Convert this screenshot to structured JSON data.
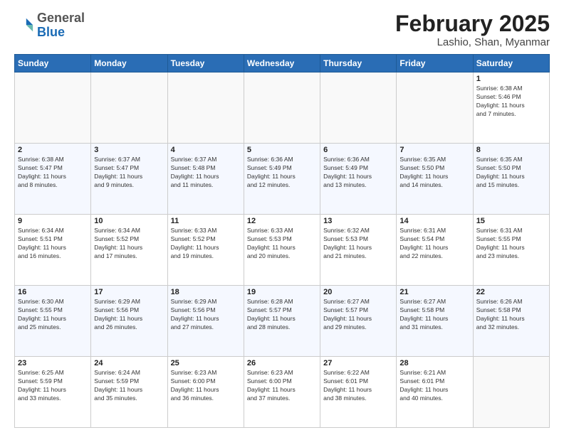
{
  "logo": {
    "general": "General",
    "blue": "Blue"
  },
  "header": {
    "title": "February 2025",
    "subtitle": "Lashio, Shan, Myanmar"
  },
  "weekdays": [
    "Sunday",
    "Monday",
    "Tuesday",
    "Wednesday",
    "Thursday",
    "Friday",
    "Saturday"
  ],
  "weeks": [
    [
      {
        "day": "",
        "info": ""
      },
      {
        "day": "",
        "info": ""
      },
      {
        "day": "",
        "info": ""
      },
      {
        "day": "",
        "info": ""
      },
      {
        "day": "",
        "info": ""
      },
      {
        "day": "",
        "info": ""
      },
      {
        "day": "1",
        "info": "Sunrise: 6:38 AM\nSunset: 5:46 PM\nDaylight: 11 hours\nand 7 minutes."
      }
    ],
    [
      {
        "day": "2",
        "info": "Sunrise: 6:38 AM\nSunset: 5:47 PM\nDaylight: 11 hours\nand 8 minutes."
      },
      {
        "day": "3",
        "info": "Sunrise: 6:37 AM\nSunset: 5:47 PM\nDaylight: 11 hours\nand 9 minutes."
      },
      {
        "day": "4",
        "info": "Sunrise: 6:37 AM\nSunset: 5:48 PM\nDaylight: 11 hours\nand 11 minutes."
      },
      {
        "day": "5",
        "info": "Sunrise: 6:36 AM\nSunset: 5:49 PM\nDaylight: 11 hours\nand 12 minutes."
      },
      {
        "day": "6",
        "info": "Sunrise: 6:36 AM\nSunset: 5:49 PM\nDaylight: 11 hours\nand 13 minutes."
      },
      {
        "day": "7",
        "info": "Sunrise: 6:35 AM\nSunset: 5:50 PM\nDaylight: 11 hours\nand 14 minutes."
      },
      {
        "day": "8",
        "info": "Sunrise: 6:35 AM\nSunset: 5:50 PM\nDaylight: 11 hours\nand 15 minutes."
      }
    ],
    [
      {
        "day": "9",
        "info": "Sunrise: 6:34 AM\nSunset: 5:51 PM\nDaylight: 11 hours\nand 16 minutes."
      },
      {
        "day": "10",
        "info": "Sunrise: 6:34 AM\nSunset: 5:52 PM\nDaylight: 11 hours\nand 17 minutes."
      },
      {
        "day": "11",
        "info": "Sunrise: 6:33 AM\nSunset: 5:52 PM\nDaylight: 11 hours\nand 19 minutes."
      },
      {
        "day": "12",
        "info": "Sunrise: 6:33 AM\nSunset: 5:53 PM\nDaylight: 11 hours\nand 20 minutes."
      },
      {
        "day": "13",
        "info": "Sunrise: 6:32 AM\nSunset: 5:53 PM\nDaylight: 11 hours\nand 21 minutes."
      },
      {
        "day": "14",
        "info": "Sunrise: 6:31 AM\nSunset: 5:54 PM\nDaylight: 11 hours\nand 22 minutes."
      },
      {
        "day": "15",
        "info": "Sunrise: 6:31 AM\nSunset: 5:55 PM\nDaylight: 11 hours\nand 23 minutes."
      }
    ],
    [
      {
        "day": "16",
        "info": "Sunrise: 6:30 AM\nSunset: 5:55 PM\nDaylight: 11 hours\nand 25 minutes."
      },
      {
        "day": "17",
        "info": "Sunrise: 6:29 AM\nSunset: 5:56 PM\nDaylight: 11 hours\nand 26 minutes."
      },
      {
        "day": "18",
        "info": "Sunrise: 6:29 AM\nSunset: 5:56 PM\nDaylight: 11 hours\nand 27 minutes."
      },
      {
        "day": "19",
        "info": "Sunrise: 6:28 AM\nSunset: 5:57 PM\nDaylight: 11 hours\nand 28 minutes."
      },
      {
        "day": "20",
        "info": "Sunrise: 6:27 AM\nSunset: 5:57 PM\nDaylight: 11 hours\nand 29 minutes."
      },
      {
        "day": "21",
        "info": "Sunrise: 6:27 AM\nSunset: 5:58 PM\nDaylight: 11 hours\nand 31 minutes."
      },
      {
        "day": "22",
        "info": "Sunrise: 6:26 AM\nSunset: 5:58 PM\nDaylight: 11 hours\nand 32 minutes."
      }
    ],
    [
      {
        "day": "23",
        "info": "Sunrise: 6:25 AM\nSunset: 5:59 PM\nDaylight: 11 hours\nand 33 minutes."
      },
      {
        "day": "24",
        "info": "Sunrise: 6:24 AM\nSunset: 5:59 PM\nDaylight: 11 hours\nand 35 minutes."
      },
      {
        "day": "25",
        "info": "Sunrise: 6:23 AM\nSunset: 6:00 PM\nDaylight: 11 hours\nand 36 minutes."
      },
      {
        "day": "26",
        "info": "Sunrise: 6:23 AM\nSunset: 6:00 PM\nDaylight: 11 hours\nand 37 minutes."
      },
      {
        "day": "27",
        "info": "Sunrise: 6:22 AM\nSunset: 6:01 PM\nDaylight: 11 hours\nand 38 minutes."
      },
      {
        "day": "28",
        "info": "Sunrise: 6:21 AM\nSunset: 6:01 PM\nDaylight: 11 hours\nand 40 minutes."
      },
      {
        "day": "",
        "info": ""
      }
    ]
  ]
}
